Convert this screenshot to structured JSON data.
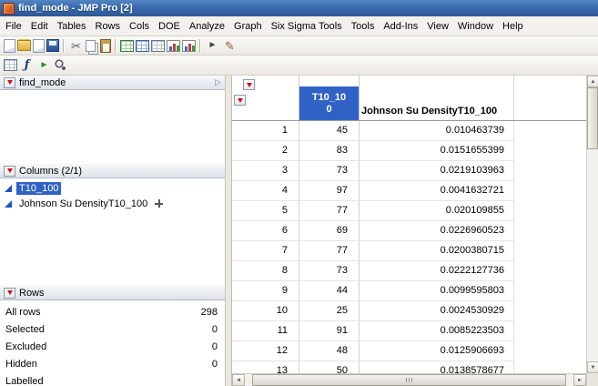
{
  "window": {
    "title": "find_mode - JMP Pro [2]"
  },
  "icons": {
    "expand_right": "▷",
    "scroll_up": "▲",
    "scroll_down": "▼",
    "scroll_left": "◄",
    "scroll_right": "►"
  },
  "menubar": {
    "items": [
      "File",
      "Edit",
      "Tables",
      "Rows",
      "Cols",
      "DOE",
      "Analyze",
      "Graph",
      "Six Sigma Tools",
      "Tools",
      "Add-Ins",
      "View",
      "Window",
      "Help"
    ]
  },
  "toolbars": {
    "row1": [
      {
        "name": "new-data-table-icon",
        "type": "doc",
        "it": "true"
      },
      {
        "name": "open-icon",
        "type": "folder",
        "it": "true"
      },
      {
        "name": "new-journal-icon",
        "type": "doc",
        "it": "true"
      },
      {
        "name": "save-icon",
        "type": "save",
        "it": "true"
      },
      {
        "name": "separator",
        "type": "sep",
        "it": "false"
      },
      {
        "name": "cut-icon",
        "type": "cut",
        "glyph": "✂",
        "it": "true"
      },
      {
        "name": "copy-icon",
        "type": "copy",
        "it": "true"
      },
      {
        "name": "paste-icon",
        "type": "paste",
        "it": "true"
      },
      {
        "name": "separator",
        "type": "sep",
        "it": "false"
      },
      {
        "name": "data-table-icon",
        "type": "grid-green",
        "it": "true"
      },
      {
        "name": "summary-table-icon",
        "type": "grid-blue",
        "it": "true"
      },
      {
        "name": "join-tables-icon",
        "type": "grid-plain",
        "it": "true"
      },
      {
        "name": "graph-builder-icon",
        "type": "chart",
        "it": "true"
      },
      {
        "name": "distribution-icon",
        "type": "chart",
        "it": "true"
      },
      {
        "name": "separator",
        "type": "sep",
        "it": "false"
      },
      {
        "name": "selection-tool-icon",
        "type": "arrow",
        "glyph": "►",
        "it": "true"
      },
      {
        "name": "annotate-icon",
        "type": "pencil",
        "glyph": "✎",
        "it": "true"
      }
    ],
    "row2": [
      {
        "name": "grid-view-icon",
        "type": "grid-plain",
        "it": "true"
      },
      {
        "name": "formula-editor-icon",
        "type": "formula",
        "glyph": "ƒ",
        "it": "true"
      },
      {
        "name": "run-script-icon",
        "type": "run",
        "glyph": "►",
        "it": "true"
      },
      {
        "name": "zoom-icon",
        "type": "zoom",
        "it": "true"
      }
    ]
  },
  "left_panel": {
    "table_panel": {
      "title": "find_mode"
    },
    "columns_panel": {
      "title": "Columns (2/1)",
      "items": [
        {
          "label": "T10_100"
        },
        {
          "label": "Johnson Su DensityT10_100"
        }
      ]
    },
    "rows_panel": {
      "title": "Rows",
      "stats": [
        {
          "label": "All rows",
          "value": "298"
        },
        {
          "label": "Selected",
          "value": "0"
        },
        {
          "label": "Excluded",
          "value": "0"
        },
        {
          "label": "Hidden",
          "value": "0"
        },
        {
          "label": "Labelled",
          "value": ""
        }
      ]
    }
  },
  "table": {
    "columns": {
      "t10": {
        "full": "T10_100",
        "line1": "T10_10",
        "line2": "0"
      },
      "density": {
        "header": "Johnson Su DensityT10_100"
      }
    },
    "rows": [
      {
        "n": "1",
        "t10": "45",
        "d": "0.010463739"
      },
      {
        "n": "2",
        "t10": "83",
        "d": "0.0151655399"
      },
      {
        "n": "3",
        "t10": "73",
        "d": "0.0219103963"
      },
      {
        "n": "4",
        "t10": "97",
        "d": "0.0041632721"
      },
      {
        "n": "5",
        "t10": "77",
        "d": "0.020109855"
      },
      {
        "n": "6",
        "t10": "69",
        "d": "0.0226960523"
      },
      {
        "n": "7",
        "t10": "77",
        "d": "0.0200380715"
      },
      {
        "n": "8",
        "t10": "73",
        "d": "0.0222127736"
      },
      {
        "n": "9",
        "t10": "44",
        "d": "0.0099595803"
      },
      {
        "n": "10",
        "t10": "25",
        "d": "0.0024530929"
      },
      {
        "n": "11",
        "t10": "91",
        "d": "0.0085223503"
      },
      {
        "n": "12",
        "t10": "48",
        "d": "0.0125906693"
      },
      {
        "n": "13",
        "t10": "50",
        "d": "0.0138578677"
      }
    ]
  }
}
